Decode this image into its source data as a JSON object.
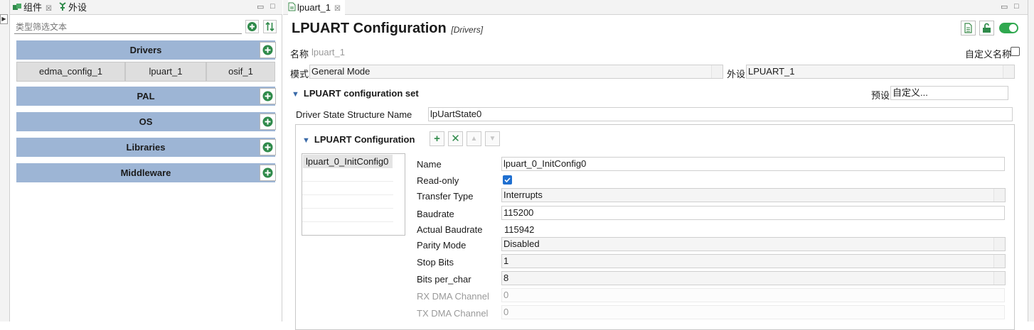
{
  "left_panel": {
    "tabs": [
      {
        "label": "组件",
        "icon": "components-icon"
      },
      {
        "label": "外设",
        "icon": "peripherals-icon"
      }
    ],
    "filter_placeholder": "类型筛选文本",
    "categories": [
      {
        "label": "Drivers",
        "items": [
          "edma_config_1",
          "lpuart_1",
          "osif_1"
        ]
      },
      {
        "label": "PAL",
        "items": []
      },
      {
        "label": "OS",
        "items": []
      },
      {
        "label": "Libraries",
        "items": []
      },
      {
        "label": "Middleware",
        "items": []
      }
    ]
  },
  "editor": {
    "tab_label": "lpuart_1",
    "title": "LPUART Configuration",
    "subtitle": "[Drivers]",
    "name_label": "名称",
    "name_value": "lpuart_1",
    "custom_name_label": "自定义名称",
    "custom_name_checked": false,
    "mode_label": "模式",
    "mode_value": "General Mode",
    "peripheral_label": "外设",
    "peripheral_value": "LPUART_1",
    "config_set_label": "LPUART configuration set",
    "preset_label": "预设",
    "preset_value": "自定义...",
    "driver_state_label": "Driver State Structure Name",
    "driver_state_value": "lpUartState0",
    "config_group_label": "LPUART Configuration",
    "config_list": [
      "lpuart_0_InitConfig0"
    ],
    "props": {
      "name_label": "Name",
      "name_value": "lpuart_0_InitConfig0",
      "readonly_label": "Read-only",
      "readonly_checked": true,
      "transfer_label": "Transfer Type",
      "transfer_value": "Interrupts",
      "baudrate_label": "Baudrate",
      "baudrate_value": "115200",
      "actual_baud_label": "Actual Baudrate",
      "actual_baud_value": "115942",
      "parity_label": "Parity Mode",
      "parity_value": "Disabled",
      "stop_label": "Stop Bits",
      "stop_value": "1",
      "bits_label": "Bits per_char",
      "bits_value": "8",
      "rxdma_label": "RX DMA Channel",
      "rxdma_value": "0",
      "txdma_label": "TX DMA Channel",
      "txdma_value": "0"
    }
  },
  "colors": {
    "category_bar": "#9db5d5",
    "accent_green": "#2fa84f",
    "checkbox_blue": "#1f6fd0"
  }
}
